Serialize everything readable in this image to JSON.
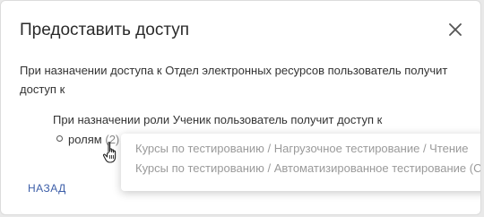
{
  "dialog": {
    "title": "Предоставить доступ",
    "close_icon": "close-icon",
    "description": "При назначении доступа к Отдел электронных ресурсов пользователь получит доступ к",
    "role_line": "При назначении роли Ученик пользователь получит доступ к",
    "roles_label": "ролям",
    "roles_count": "(2)",
    "back_label": "НАЗАД"
  },
  "tooltip": {
    "items": [
      "Курсы по тестированию / Нагрузочное тестирование / Чтение",
      "Курсы по тестированию / Автоматизированное тестирование (Сел"
    ]
  },
  "colors": {
    "link": "#3c5ea8",
    "text": "#333333",
    "muted": "#9a9a9a"
  },
  "icons": {
    "cursor": "hand-pointer-icon"
  }
}
